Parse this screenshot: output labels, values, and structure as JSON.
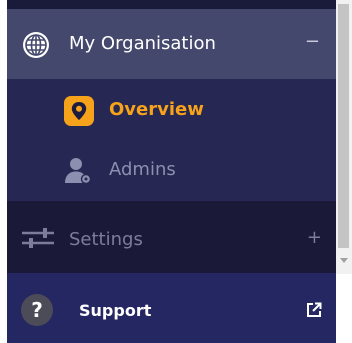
{
  "nav": {
    "org": {
      "label": "My Organisation",
      "toggle": "−",
      "icon": "globe-icon"
    },
    "overview": {
      "label": "Overview",
      "icon": "location-pin-icon"
    },
    "admins": {
      "label": "Admins",
      "icon": "admin-user-icon"
    },
    "settings": {
      "label": "Settings",
      "toggle": "+",
      "icon": "sliders-icon"
    },
    "support": {
      "label": "Support",
      "icon": "help-icon",
      "glyph": "?",
      "external_icon": "external-link-icon"
    }
  },
  "colors": {
    "nav_background": "#1c1c3f",
    "org_background": "#45486d",
    "submenu_background": "#262752",
    "accent": "#f6a21a",
    "support_background": "#242761"
  }
}
